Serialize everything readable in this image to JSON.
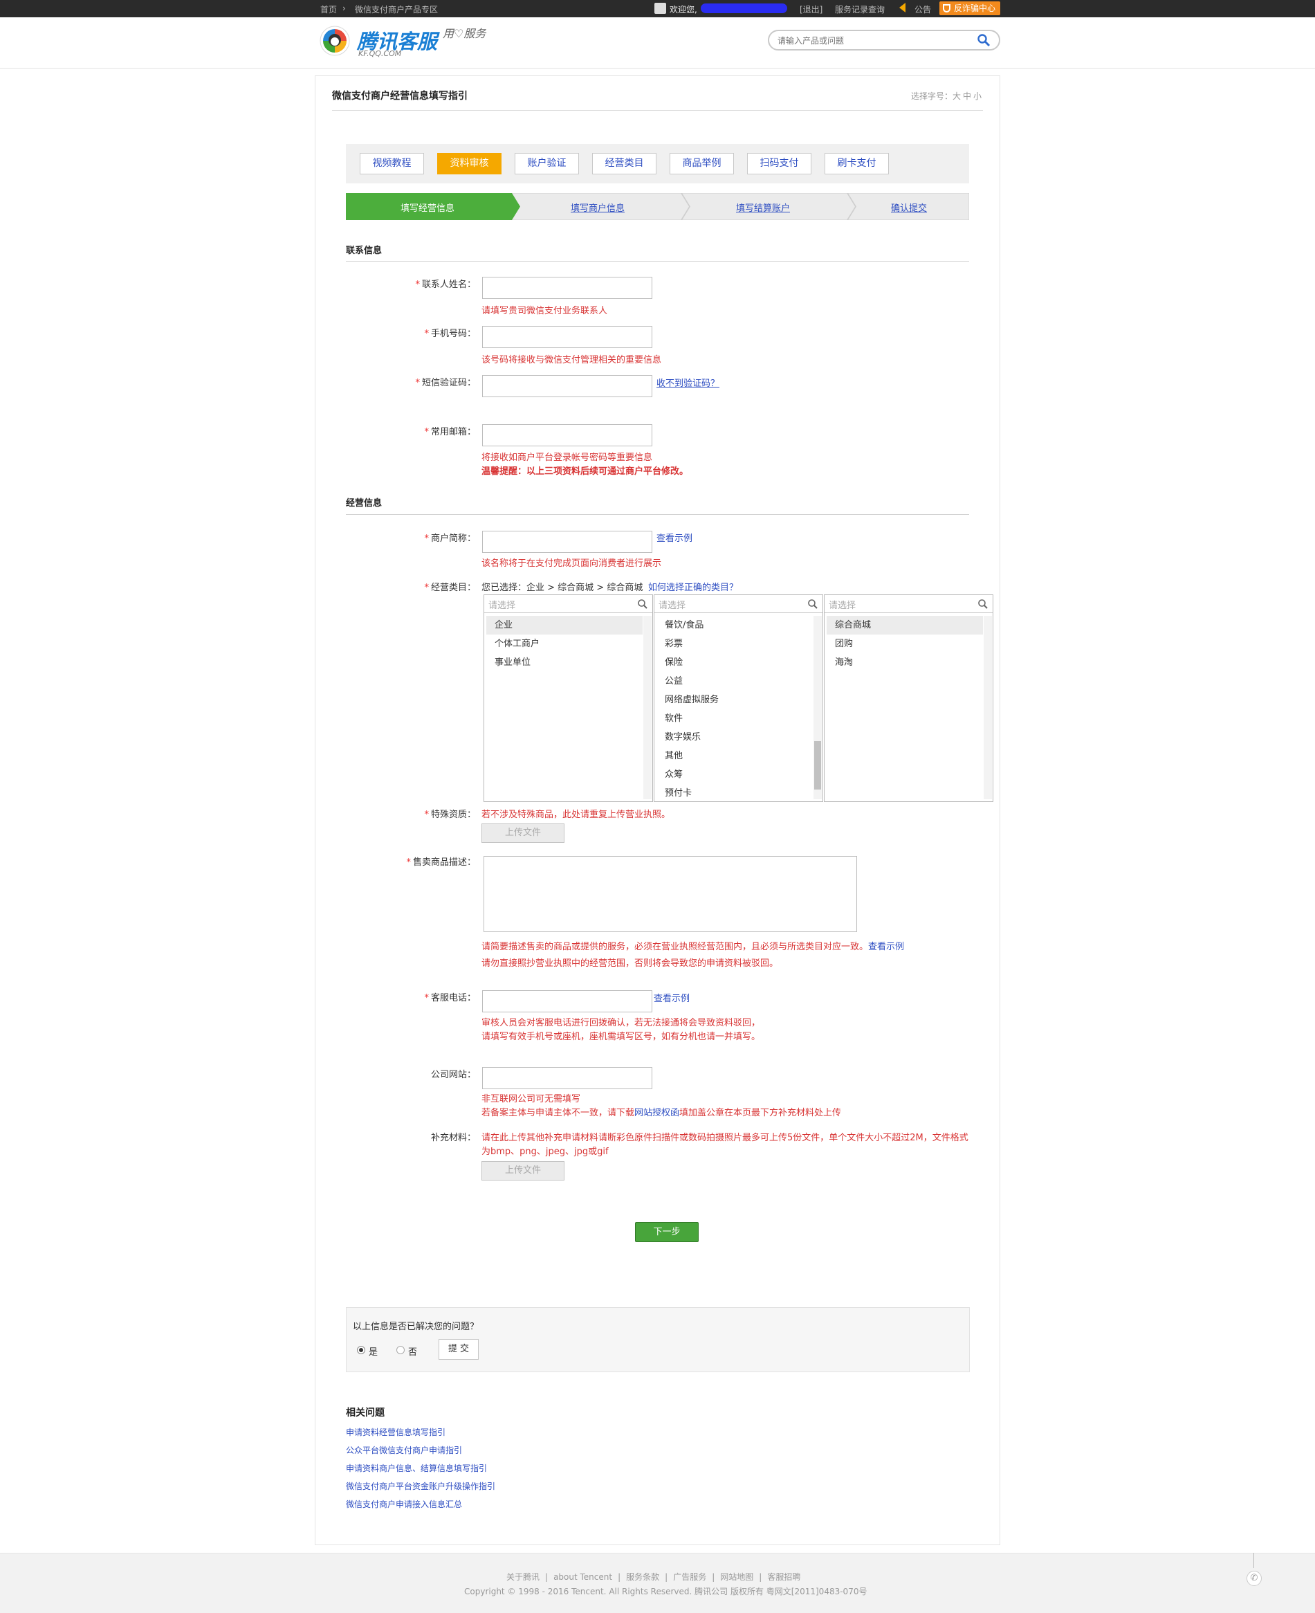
{
  "topbar": {
    "home": "首页",
    "sep": "›",
    "zone": "微信支付商户产品专区",
    "welcome": "欢迎您,",
    "logout": "[退出]",
    "records": "服务记录查询",
    "notice": "公告",
    "anti_fraud": "反诈骗中心"
  },
  "header": {
    "logo_main": "腾讯客服",
    "logo_sub": "KF.QQ.COM",
    "slogan": "用♡服务",
    "search_placeholder": "请输入产品或问题"
  },
  "page": {
    "title": "微信支付商户经营信息填写指引",
    "font_size_label": "选择字号：",
    "font_sizes": [
      "大",
      "中",
      "小"
    ]
  },
  "tabs": [
    {
      "label": "视频教程"
    },
    {
      "label": "资料审核"
    },
    {
      "label": "账户验证"
    },
    {
      "label": "经营类目"
    },
    {
      "label": "商品举例"
    },
    {
      "label": "扫码支付"
    },
    {
      "label": "刷卡支付"
    }
  ],
  "steps": [
    {
      "label": "填写经营信息"
    },
    {
      "label": "填写商户信息"
    },
    {
      "label": "填写结算账户"
    },
    {
      "label": "确认提交"
    }
  ],
  "contact": {
    "section": "联系信息",
    "name_label": "联系人姓名：",
    "name_hint": "请填写贵司微信支付业务联系人",
    "phone_label": "手机号码：",
    "phone_hint": "该号码将接收与微信支付管理相关的重要信息",
    "sms_label": "短信验证码：",
    "sms_link": "收不到验证码？",
    "email_label": "常用邮箱：",
    "email_hint": "将接收如商户平台登录帐号密码等重要信息",
    "warm_tip": "温馨提醒：以上三项资料后续可通过商户平台修改。"
  },
  "business": {
    "section": "经营信息",
    "short_name_label": "商户简称：",
    "short_name_example": "查看示例",
    "short_name_hint": "该名称将于在支付完成页面向消费者进行展示",
    "category_label": "经营类目：",
    "category_selected": "您已选择：企业 > 综合商城 > 综合商城",
    "category_help": "如何选择正确的类目？",
    "panels": [
      {
        "placeholder": "请选择",
        "items": [
          "企业",
          "个体工商户",
          "事业单位"
        ],
        "selected": 0
      },
      {
        "placeholder": "请选择",
        "items": [
          "餐饮/食品",
          "彩票",
          "保险",
          "公益",
          "网络虚拟服务",
          "软件",
          "数字娱乐",
          "其他",
          "众筹",
          "预付卡"
        ],
        "selected": -1
      },
      {
        "placeholder": "请选择",
        "items": [
          "综合商城",
          "团购",
          "海淘"
        ],
        "selected": 0
      }
    ],
    "special_label": "特殊资质：",
    "special_hint": "若不涉及特殊商品，此处请重复上传营业执照。",
    "upload_label": "上传文件",
    "desc_label": "售卖商品描述：",
    "desc_hint1": "请简要描述售卖的商品或提供的服务，必须在营业执照经营范围内，且必须与所选类目对应一致。",
    "desc_example": "查看示例",
    "desc_hint2": "请勿直接照抄营业执照中的经营范围，否则将会导致您的申请资料被驳回。",
    "service_phone_label": "客服电话：",
    "service_phone_example": "查看示例",
    "service_phone_hint1": "审核人员会对客服电话进行回拨确认，若无法接通将会导致资料驳回，",
    "service_phone_hint2": "请填写有效手机号或座机，座机需填写区号，如有分机也请一并填写。",
    "website_label": "公司网站：",
    "website_hint1": "非互联网公司可无需填写",
    "website_hint2a": "若备案主体与申请主体不一致，请下载",
    "website_hint2_link": "网站授权函",
    "website_hint2b": "填加盖公章在本页最下方补充材料处上传",
    "supplement_label": "补充材料：",
    "supplement_hint1": "请在此上传其他补充申请材料请断彩色原件扫描件或数码拍摄照片最多可上传5份文件，单个文件大小不超过2M，文件格式",
    "supplement_hint2": "为bmp、png、jpeg、jpg或gif"
  },
  "next_button": "下一步",
  "feedback": {
    "question": "以上信息是否已解决您的问题？",
    "yes": "是",
    "no": "否",
    "submit": "提 交"
  },
  "related": {
    "title": "相关问题",
    "links": [
      "申请资料经营信息填写指引",
      "公众平台微信支付商户申请指引",
      "申请资料商户信息、结算信息填写指引",
      "微信支付商户平台资金账户升级操作指引",
      "微信支付商户申请接入信息汇总"
    ]
  },
  "footer": {
    "links": [
      "关于腾讯",
      "about Tencent",
      "服务条款",
      "广告服务",
      "网站地图",
      "客服招聘"
    ],
    "copyright": "Copyright © 1998 - 2016 Tencent. All Rights Reserved. 腾讯公司 版权所有 粤网文[2011]0483-070号"
  },
  "colors": {
    "accent_orange": "#f5a800",
    "step_green": "#4cae3c",
    "error_red": "#d83434",
    "link_blue": "#2e4ec2"
  }
}
